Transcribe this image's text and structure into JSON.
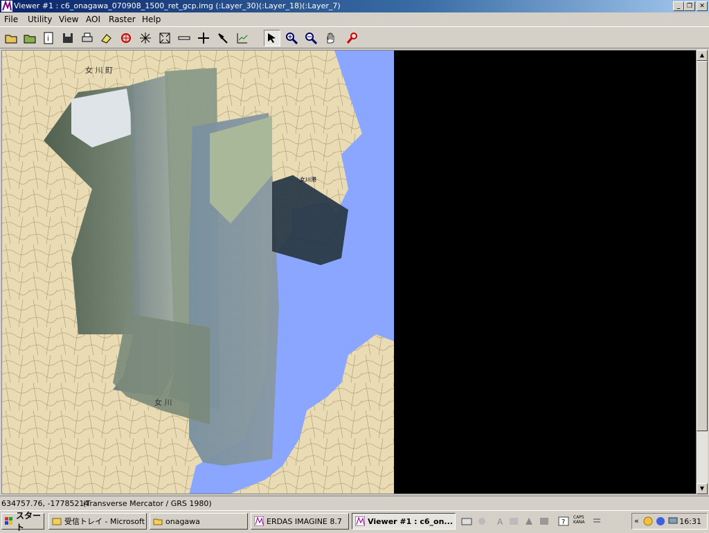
{
  "window": {
    "title": "Viewer #1 : c6_onagawa_070908_1500_ret_gcp.img (:Layer_30)(:Layer_18)(:Layer_7)"
  },
  "menu": {
    "file": "File",
    "utility": "Utility",
    "view": "View",
    "aoi": "AOI",
    "raster": "Raster",
    "help": "Help"
  },
  "map": {
    "label_town_top": "女 川 町",
    "label_town_bottom": "女 川",
    "label_harbor": "女川港",
    "colors": {
      "land": "#e9dcb4",
      "sea": "#8aa6ff",
      "background": "#000000"
    }
  },
  "status": {
    "coords": "634757.76, -17785214",
    "projection": "(Transverse Mercator / GRS 1980)"
  },
  "taskbar": {
    "start": "スタート",
    "tasks": [
      "受信トレイ - Microsoft ...",
      "onagawa",
      "ERDAS IMAGINE 8.7",
      "Viewer #1 : c6_on..."
    ],
    "ime_top": "CAPS",
    "ime_bottom": "KANA",
    "clock": "16:31"
  }
}
